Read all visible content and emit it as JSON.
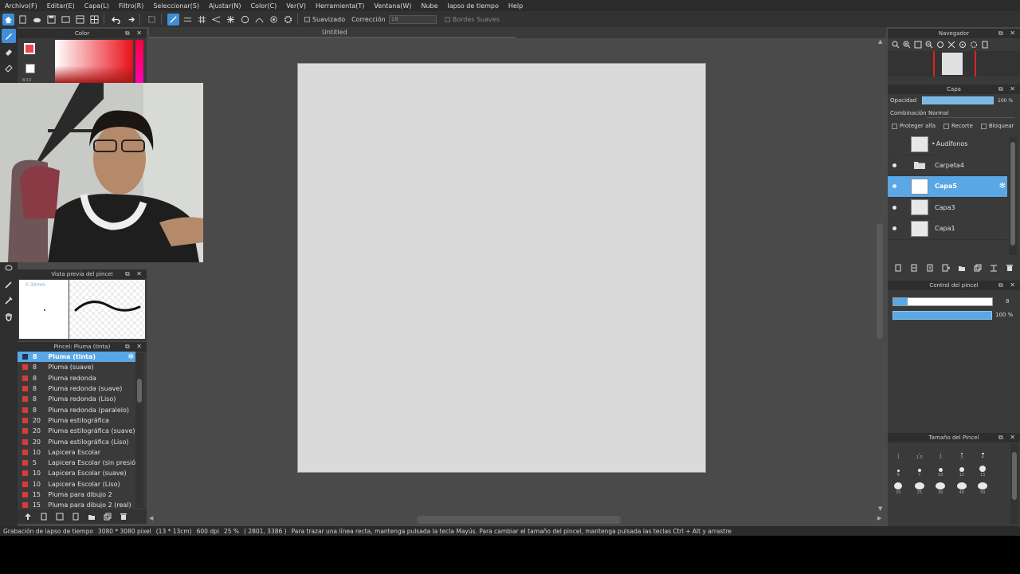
{
  "menu": [
    "Archivo(F)",
    "Editar(E)",
    "Capa(L)",
    "Filtro(R)",
    "Seleccionar(S)",
    "Ajustar(N)",
    "Color(C)",
    "Ver(V)",
    "Herramienta(T)",
    "Ventana(W)",
    "Nube",
    "lapso de tiempo",
    "Help"
  ],
  "toolbar": {
    "suavizado_label": "Suavizado",
    "correccion_label": "Corrección",
    "correccion_value": "18",
    "bordes_label": "Bordes Suaves"
  },
  "document_title": "Untitled",
  "panels": {
    "color_title": "Color",
    "color_value_text": "8/10",
    "brush_preview_title": "Vista previa del pincel",
    "brush_preview_size": "0.39mm",
    "brush_list_title": "Pincel: Pluma (tinta)",
    "navigator_title": "Navegador",
    "layer_title": "Capa",
    "opacity_label": "Opacidad",
    "opacity_value": "100 %",
    "blend_label": "Combinación",
    "blend_value": "Normal",
    "protect_alpha": "Proteger alfa",
    "clipping": "Recorte",
    "lock": "Bloquear",
    "brush_control_title": "Control del pincel",
    "brush_control_size": "8",
    "brush_control_opacity": "100 %",
    "brush_size_title": "Tamaño del Pincel"
  },
  "brushes": [
    {
      "size": "8",
      "name": "Pluma (tinta)",
      "selected": true
    },
    {
      "size": "8",
      "name": "Pluma (suave)"
    },
    {
      "size": "8",
      "name": "Pluma redonda"
    },
    {
      "size": "8",
      "name": "Pluma redonda (suave)"
    },
    {
      "size": "8",
      "name": "Pluma redonda (Liso)"
    },
    {
      "size": "8",
      "name": "Pluma redonda (paralelo)"
    },
    {
      "size": "20",
      "name": "Pluma estilográfica"
    },
    {
      "size": "20",
      "name": "Pluma estilográfica (suave)"
    },
    {
      "size": "20",
      "name": "Pluma estilográfica (Liso)"
    },
    {
      "size": "10",
      "name": "Lapicera Escolar"
    },
    {
      "size": "5",
      "name": "Lapicera Escolar (sin presión d"
    },
    {
      "size": "10",
      "name": "Lapicera Escolar (suave)"
    },
    {
      "size": "10",
      "name": "Lapicera Escolar (Liso)"
    },
    {
      "size": "15",
      "name": "Pluma para dibujo 2"
    },
    {
      "size": "15",
      "name": "Pluma para dibujo 2 (real)"
    }
  ],
  "layers": [
    {
      "name": "Audífonos",
      "prefix": "•",
      "visible": false
    },
    {
      "name": "Carpeta4",
      "folder": true,
      "visible": true
    },
    {
      "name": "Capa5",
      "selected": true,
      "visible": true
    },
    {
      "name": "Capa3",
      "visible": true
    },
    {
      "name": "Capa1",
      "visible": true
    }
  ],
  "brush_sizes": [
    [
      "1",
      "1.5",
      "2",
      "3",
      "4"
    ],
    [
      "5",
      "7",
      "10",
      "12",
      "15"
    ],
    [
      "20",
      "25",
      "30",
      "40",
      "50"
    ]
  ],
  "status": {
    "recording": "Grabación de lapso de tiempo",
    "size": "3080 * 3080 pixel",
    "cm": "(13 * 13cm)",
    "dpi": "600 dpi",
    "zoom": "25 %",
    "coords": "( 2801, 3386 )",
    "hint": "Para trazar una línea recta, mantenga pulsada la tecla Mayús. Para cambiar el tamaño del pincel, mantenga pulsada las teclas Ctrl + Alt y arrastre"
  }
}
